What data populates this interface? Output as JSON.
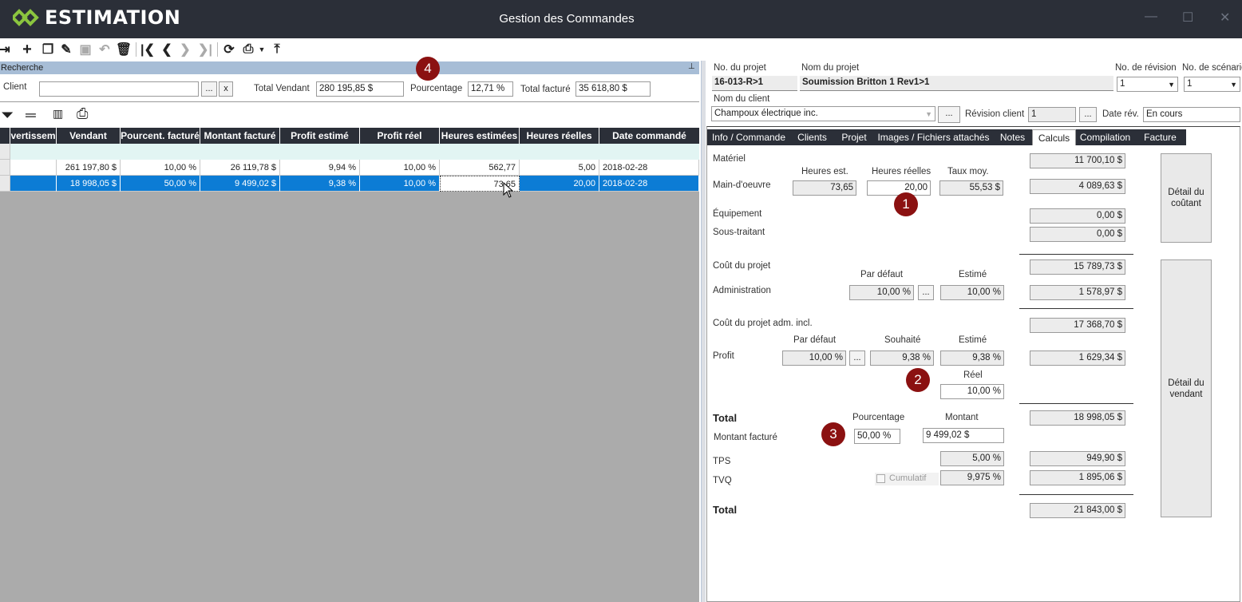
{
  "app": {
    "logo_text": "ESTIMATION",
    "window_title": "Gestion des Commandes",
    "accent": "#8bc53f",
    "dark": "#2b2f38",
    "select_blue": "#0c7cd5",
    "badge_red": "#8b1111"
  },
  "toolbar": {
    "icons": [
      "exit-icon",
      "add-icon",
      "copy-icon",
      "edit-icon",
      "save-icon",
      "undo-icon",
      "delete-icon",
      "first-icon",
      "prev-icon",
      "next-icon",
      "last-icon",
      "refresh-icon",
      "print-icon",
      "export-icon"
    ]
  },
  "search": {
    "header": "Recherche",
    "client_label": "Client",
    "client_value": "",
    "browse": "...",
    "clear": "x",
    "total_vendant_label": "Total Vendant",
    "total_vendant": "280 195,85 $",
    "pourcentage_label": "Pourcentage",
    "pourcentage": "12,71 %",
    "total_facture_label": "Total facturé",
    "total_facture": "35 618,80 $"
  },
  "grid": {
    "columns": [
      "vertissem",
      "Vendant",
      "Pourcent. facturé",
      "Montant facturé",
      "Profit estimé",
      "Profit réel",
      "Heures estimées",
      "Heures réelles",
      "Date commandé"
    ],
    "rows": [
      [
        "",
        "261 197,80 $",
        "10,00 %",
        "26 119,78 $",
        "9,94 %",
        "10,00 %",
        "562,77",
        "5,00",
        "2018-02-28"
      ],
      [
        "",
        "18 998,05 $",
        "50,00 %",
        "9 499,02 $",
        "9,38 %",
        "10,00 %",
        "73,65",
        "20,00",
        "2018-02-28"
      ]
    ]
  },
  "project": {
    "no_projet_label": "No. du projet",
    "no_projet": "16-013-R>1",
    "nom_projet_label": "Nom du projet",
    "nom_projet": "Soumission Britton 1 Rev1>1",
    "no_revision_label": "No. de révision",
    "no_revision": "1",
    "no_scenario_label": "No. de scénario",
    "no_scenario": "1",
    "nom_client_label": "Nom du client",
    "nom_client": "Champoux électrique inc.",
    "revision_client_label": "Révision client",
    "revision_client": "1",
    "date_rev_label": "Date rév.",
    "date_rev": "En cours",
    "browse": "..."
  },
  "tabs": [
    "Info / Commande",
    "Clients",
    "Projet",
    "Images / Fichiers attachés",
    "Notes",
    "Calculs",
    "Compilation",
    "Facture"
  ],
  "calc": {
    "materiel_label": "Matériel",
    "materiel": "11 700,10 $",
    "heures_est_label": "Heures est.",
    "heures_reelles_label": "Heures réelles",
    "taux_moy_label": "Taux moy.",
    "main_oeuvre_label": "Main-d'oeuvre",
    "heures_est": "73,65",
    "heures_reelles": "20,00",
    "taux_moy": "55,53 $",
    "main_oeuvre": "4 089,63 $",
    "equipement_label": "Équipement",
    "equipement": "0,00 $",
    "sous_traitant_label": "Sous-traitant",
    "sous_traitant": "0,00 $",
    "detail_coutant": "Détail du coûtant",
    "cout_projet_label": "Coût du projet",
    "cout_projet": "15 789,73 $",
    "par_defaut_label": "Par défaut",
    "estime_label": "Estimé",
    "souhaite_label": "Souhaité",
    "reel_label": "Réel",
    "administration_label": "Administration",
    "admin_defaut": "10,00 %",
    "admin_estime": "10,00 %",
    "administration": "1 578,97 $",
    "cout_adm_label": "Coût du projet adm. incl.",
    "cout_adm": "17 368,70 $",
    "profit_label": "Profit",
    "profit_defaut": "10,00 %",
    "profit_souhaite": "9,38 %",
    "profit_estime": "9,38 %",
    "profit": "1 629,34 $",
    "profit_reel": "10,00 %",
    "detail_vendant": "Détail du vendant",
    "total_label": "Total",
    "total": "18 998,05 $",
    "pourcentage_label": "Pourcentage",
    "montant_label": "Montant",
    "montant_facture_label": "Montant facturé",
    "facture_pct": "50,00 %",
    "facture_montant": "9 499,02 $",
    "tps_label": "TPS",
    "tps_pct": "5,00 %",
    "tps": "949,90 $",
    "tvq_label": "TVQ",
    "cumulatif_label": "Cumulatif",
    "tvq_pct": "9,975 %",
    "tvq": "1 895,06 $",
    "grand_total_label": "Total",
    "grand_total": "21 843,00 $",
    "browse": "..."
  },
  "badges": [
    "1",
    "2",
    "3",
    "4"
  ]
}
